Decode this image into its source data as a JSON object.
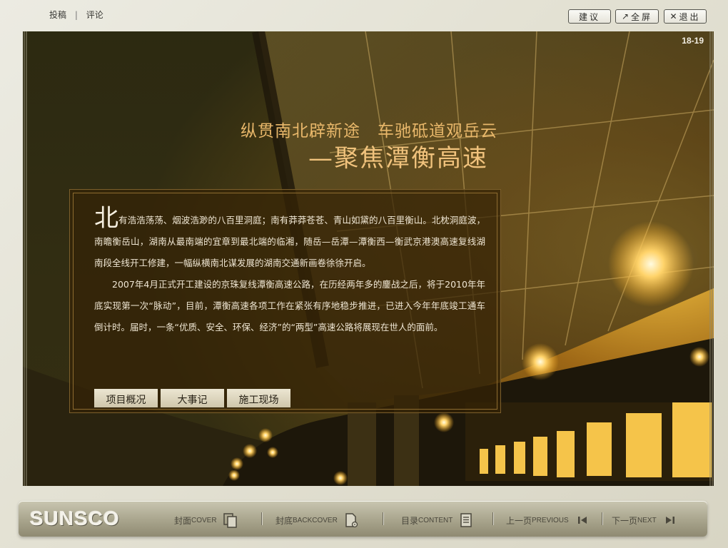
{
  "top_links": {
    "submit": "投稿",
    "comment": "评论"
  },
  "top_buttons": {
    "suggest": "建议",
    "fullscreen": "全屏",
    "exit": "退出"
  },
  "page_number": "18-19",
  "headline": {
    "line1": "纵贯南北辟新途　车驰砥道观岳云",
    "line2": "—聚焦潭衡高速"
  },
  "article": {
    "drop_char": "北",
    "para1": "有浩浩荡荡、烟波浩渺的八百里洞庭；南有莽莽苍苍、青山如黛的八百里衡山。北枕洞庭波，南瞻衡岳山，湖南从最南端的宜章到最北端的临湘，随岳—岳潭—潭衡西—衡武京港澳高速复线湖南段全线开工修建，一幅纵横南北谋发展的湖南交通新画卷徐徐开启。",
    "para2": "2007年4月正式开工建设的京珠复线潭衡高速公路，在历经两年多的鏖战之后，将于2010年年底实现第一次“脉动”，目前，潭衡高速各项工作在紧张有序地稳步推进，已进入今年年底竣工通车倒计时。届时，一条“优质、安全、环保、经济”的“两型”高速公路将展现在世人的面前。"
  },
  "tabs": [
    "项目概况",
    "大事记",
    "施工现场"
  ],
  "bottom_bar": {
    "logo": "SUNSCO",
    "cover": {
      "cn": "封面",
      "en": "COVER"
    },
    "backcover": {
      "cn": "封底",
      "en": "BACKCOVER"
    },
    "content": {
      "cn": "目录",
      "en": "CONTENT"
    },
    "previous": {
      "cn": "上一页",
      "en": "PREVIOUS"
    },
    "next": {
      "cn": "下一页",
      "en": "NEXT"
    }
  },
  "colors": {
    "headline": "#e8b76a",
    "accent_gold": "#f0c27c",
    "panel": "#34220a"
  }
}
